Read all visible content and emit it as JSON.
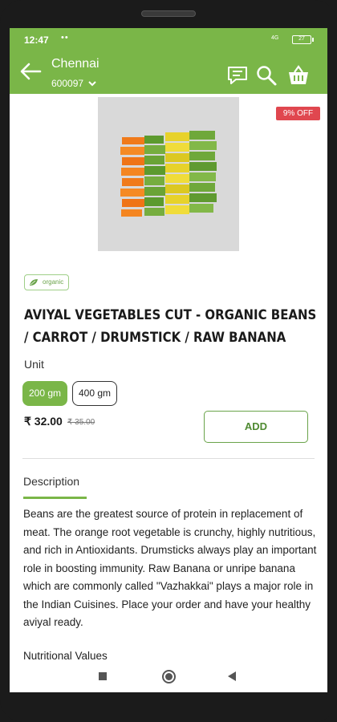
{
  "status": {
    "time": "12:47",
    "dots": "••",
    "signal": "4G",
    "battery": "27"
  },
  "header": {
    "city": "Chennai",
    "pincode": "600097",
    "chevron": "⌄"
  },
  "icons": {
    "back": "back-arrow-icon",
    "chat": "chat-icon",
    "search": "search-icon",
    "basket": "basket-icon"
  },
  "product": {
    "discount_badge": "9% OFF",
    "organic_tag": "organic",
    "title": "AVIYAL VEGETABLES CUT - ORGANIC BEANS / CARROT / DRUMSTICK / RAW BANANA",
    "unit_label": "Unit",
    "variants": [
      {
        "label": "200 gm",
        "selected": true
      },
      {
        "label": "400 gm",
        "selected": false
      }
    ],
    "price": "₹ 32.00",
    "mrp": "₹ 35.00",
    "add_label": "ADD"
  },
  "description": {
    "tab_label": "Description",
    "text": "Beans are the greatest source of protein in replacement of meat. The orange root vegetable is crunchy, highly nutritious, and rich in Antioxidants. Drumsticks always play an important role in boosting immunity. Raw Banana or unripe banana which are commonly called \"Vazhakkai\" plays a major role in the Indian Cuisines. Place your order and have your healthy aviyal ready.",
    "nutritional_label": "Nutritional Values"
  },
  "colors": {
    "primary": "#7ab648",
    "badge": "#e0474f",
    "carrot": "#f07a1a",
    "beans": "#6fa83a",
    "banana": "#e7d22b"
  }
}
